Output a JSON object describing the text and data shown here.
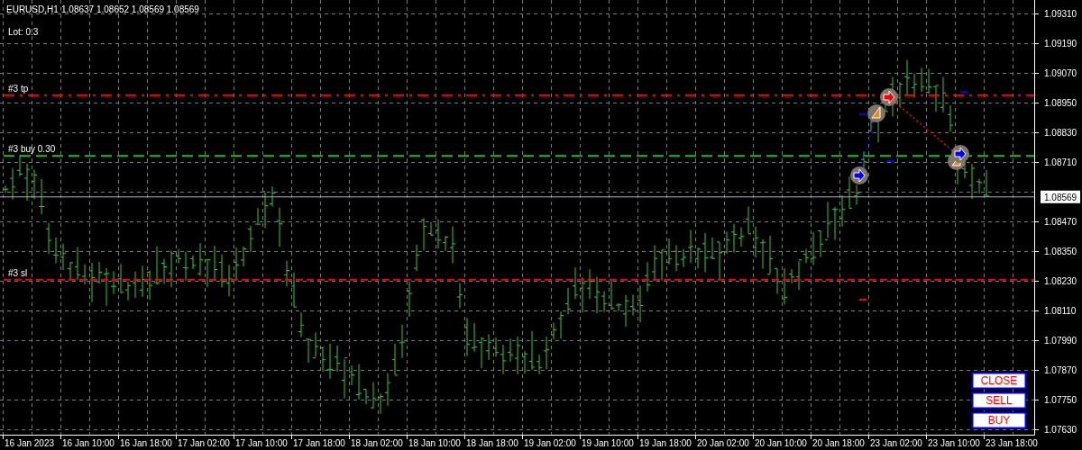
{
  "header": {
    "symbol": "EURUSD,H1",
    "quote": "1.08637 1.08652 1.08569 1.08569"
  },
  "lot": "Lot: 0.3",
  "order_lines": [
    {
      "label": "#3 tp",
      "kind": "tp"
    },
    {
      "label": "#3 buy 0.30",
      "kind": "entry"
    },
    {
      "label": "#3 sl",
      "kind": "sl"
    }
  ],
  "price_axis": {
    "labels": [
      "1.09310",
      "1.09190",
      "1.09070",
      "1.08950",
      "1.08830",
      "1.08710",
      "1.08470",
      "1.08350",
      "1.08230",
      "1.08110",
      "1.07990",
      "1.07870",
      "1.07750",
      "1.07630"
    ],
    "current_price": "1.08569"
  },
  "time_axis": {
    "labels": [
      "16 Jan 2023",
      "16 Jan 10:00",
      "16 Jan 18:00",
      "17 Jan 02:00",
      "17 Jan 10:00",
      "17 Jan 18:00",
      "18 Jan 02:00",
      "18 Jan 10:00",
      "18 Jan 18:00",
      "19 Jan 02:00",
      "19 Jan 10:00",
      "19 Jan 18:00",
      "20 Jan 02:00",
      "20 Jan 10:00",
      "20 Jan 18:00",
      "23 Jan 02:00",
      "23 Jan 10:00",
      "23 Jan 18:00"
    ]
  },
  "buttons": [
    "CLOSE",
    "SELL",
    "BUY"
  ]
}
